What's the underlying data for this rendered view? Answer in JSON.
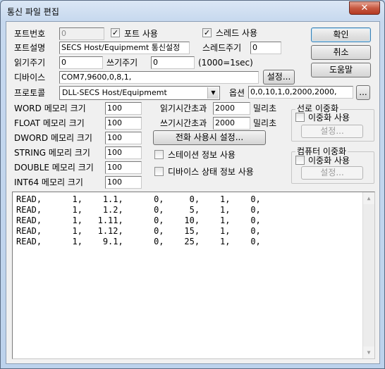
{
  "window": {
    "title": "통신 파일 편집",
    "close_label": "✕"
  },
  "port": {
    "label_number": "포트번호",
    "number_value": "0",
    "use_label": "포트 사용",
    "use_checked": true,
    "label_desc": "포트설명",
    "desc_value": "SECS Host/Equipmemt 통신설정"
  },
  "thread": {
    "use_label": "스레드 사용",
    "use_checked": true,
    "period_label": "스레드주기",
    "period_value": "0"
  },
  "cycle": {
    "read_label": "읽기주기",
    "read_value": "0",
    "write_label": "쓰기주기",
    "write_value": "0",
    "unit_note": "(1000=1sec)"
  },
  "device": {
    "label": "디바이스",
    "value": "COM7,9600,0,8,1,",
    "setup_button": "설정..."
  },
  "protocol": {
    "label": "프로토콜",
    "value": "DLL-SECS Host/Equipmemt",
    "options_label": "옵션",
    "options_value": "0,0,10,1,0,2000,2000,",
    "more_button": "..."
  },
  "memory": {
    "word_label": "WORD 메모리 크기",
    "word_value": "100",
    "float_label": "FLOAT 메모리 크기",
    "float_value": "100",
    "dword_label": "DWORD 메모리 크기",
    "dword_value": "100",
    "string_label": "STRING 메모리 크기",
    "string_value": "100",
    "double_label": "DOUBLE 메모리 크기",
    "double_value": "100",
    "int64_label": "INT64 메모리 크기",
    "int64_value": "100"
  },
  "timeout": {
    "read_label": "읽기시간초과",
    "read_value": "2000",
    "read_unit": "밀리초",
    "write_label": "쓰기시간초과",
    "write_value": "2000",
    "write_unit": "밀리초",
    "phone_button": "전화 사용시 설정..."
  },
  "options": {
    "station_info_label": "스테이션 정보 사용",
    "station_info_checked": false,
    "device_state_label": "디바이스 상태 정보 사용",
    "device_state_checked": false
  },
  "buttons": {
    "ok": "확인",
    "cancel": "취소",
    "help": "도움말"
  },
  "line_redundancy": {
    "title": "선로 이중화",
    "check_label": "이중화 사용",
    "checked": false,
    "setup_button": "설정..."
  },
  "computer_redundancy": {
    "title": "컴퓨터 이중화",
    "check_label": "이중화 사용",
    "checked": false,
    "setup_button": "설정..."
  },
  "editor": {
    "lines": [
      "READ,      1,    1.1,      0,     0,    1,    0,",
      "READ,      1,    1.2,      0,     5,    1,    0,",
      "READ,      1,   1.11,      0,    10,    1,    0,",
      "READ,      1,   1.12,      0,    15,    1,    0,",
      "READ,      1,    9.1,      0,    25,    1,    0,"
    ]
  },
  "icons": {
    "check": "check-mark",
    "dropdown": "chevron-down-icon",
    "scroll_up": "arrow-up-icon",
    "scroll_down": "arrow-down-icon"
  }
}
